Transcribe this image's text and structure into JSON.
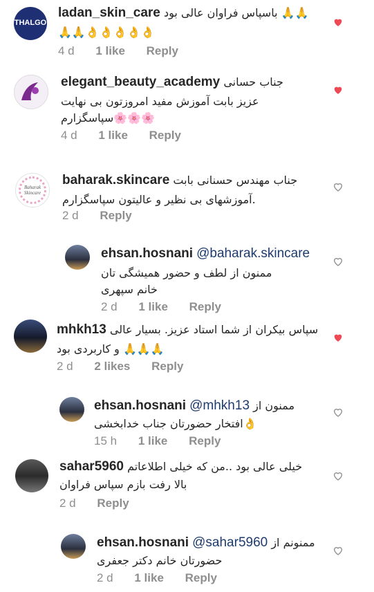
{
  "comments": [
    {
      "username": "ladan_skin_care",
      "text_line1": "🙏🙏 باسپاس فراوان عالی بود",
      "text_line2": "🙏🙏👌👌👌👌👌",
      "time": "4 d",
      "likes": "1 like",
      "reply": "Reply",
      "liked": true,
      "avatar_text": "THALGO"
    },
    {
      "username": "elegant_beauty_academy",
      "text_line1": "جناب حسانی",
      "text_line2": "عزیز بابت آموزش مفید امروزتون بی نهایت",
      "text_line3": "🌸🌸🌸سپاسگزارم",
      "time": "4 d",
      "likes": "1 like",
      "reply": "Reply",
      "liked": true
    },
    {
      "username": "baharak.skincare",
      "text_line1": "جناب مهندس حسنانی بابت",
      "text_line2": ".آموزشهای بی نظیر و عالیتون سپاسگزارم",
      "time": "2 d",
      "reply": "Reply",
      "liked": false,
      "avatar_text": "Baharak Skincare"
    },
    {
      "username": "ehsan.hosnani",
      "mention": "@baharak.skincare",
      "text_line1": "ممنون از لطف و حضور همیشگی تان",
      "text_line2": "خانم سپهری",
      "time": "2 d",
      "likes": "1 like",
      "reply": "Reply",
      "liked": false
    },
    {
      "username": "mhkh13",
      "text_line1": "سپاس بیکران از شما استاد عزیز. بسیار عالی",
      "text_line2": "🙏🙏🙏 و کاربردی بود",
      "time": "2 d",
      "likes": "2 likes",
      "reply": "Reply",
      "liked": true
    },
    {
      "username": "ehsan.hosnani",
      "mention": "@mhkh13",
      "text_line1": "ممنون از",
      "text_line2": "👌افتخار حضورتان جناب خدابخشی",
      "time": "15 h",
      "likes": "1 like",
      "reply": "Reply",
      "liked": false
    },
    {
      "username": "sahar5960",
      "text_line1": "خیلی عالی بود ..من که خیلی اطلاعاتم",
      "text_line2": "بالا رفت بازم سپاس فراوان",
      "time": "2 d",
      "reply": "Reply",
      "liked": false
    },
    {
      "username": "ehsan.hosnani",
      "mention": "@sahar5960",
      "text_line1": "ممنونم از",
      "text_line2": "حضورتان خانم دکتر جعفری",
      "time": "2 d",
      "likes": "1 like",
      "reply": "Reply",
      "liked": false
    }
  ]
}
